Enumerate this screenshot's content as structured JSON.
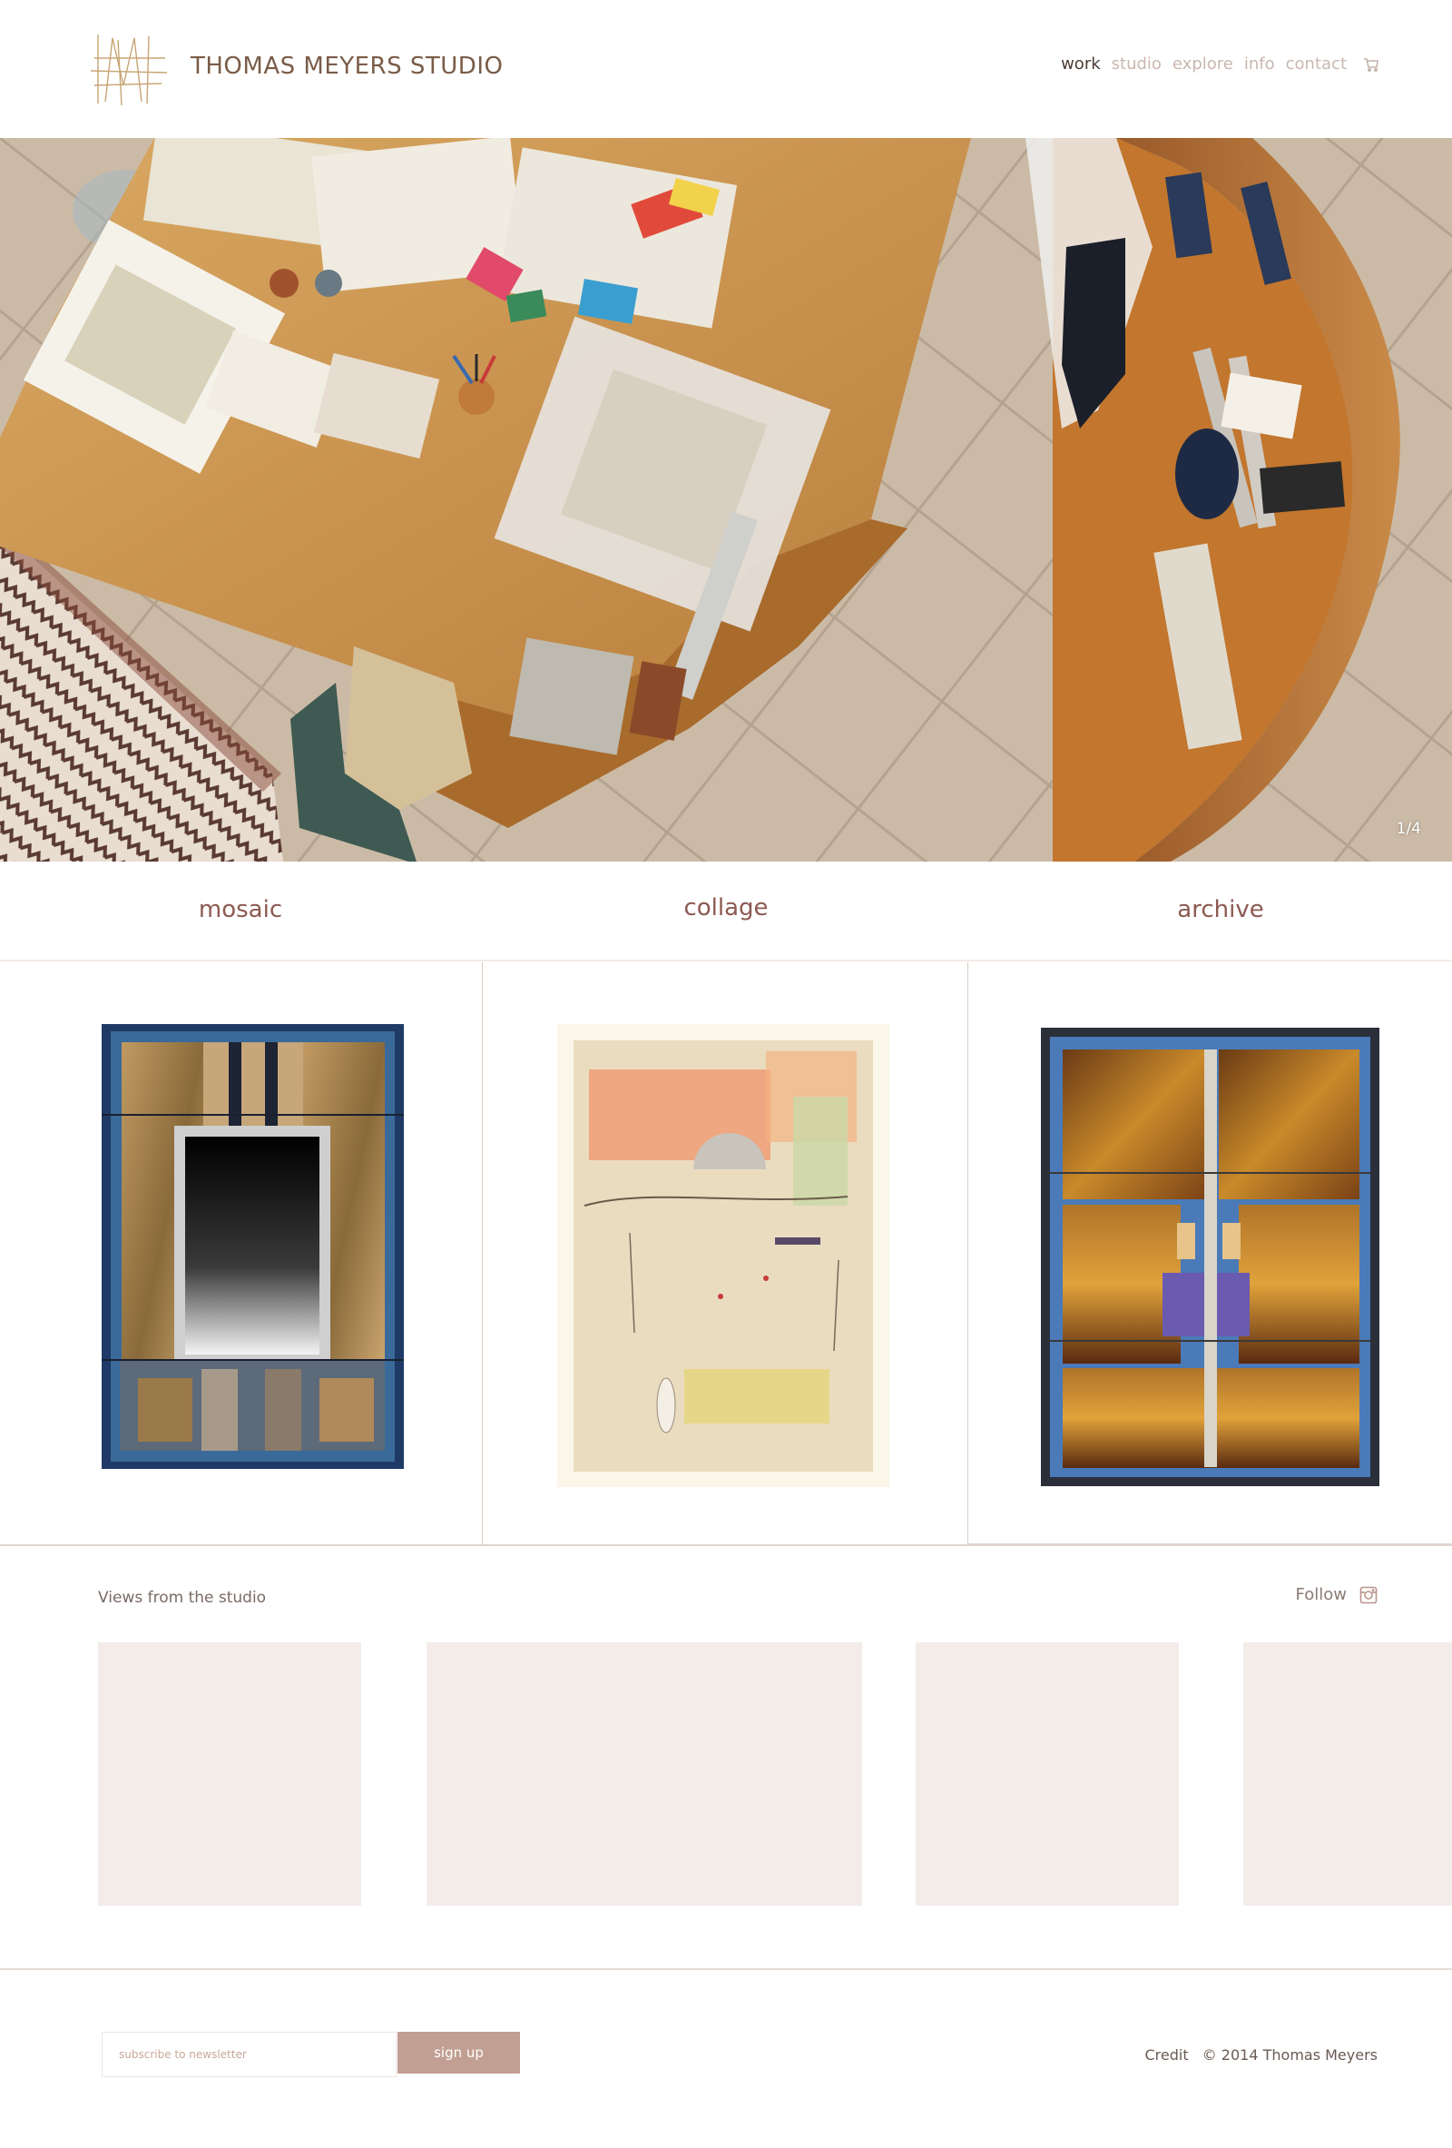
{
  "header": {
    "brand": "THOMAS MEYERS STUDIO",
    "nav": [
      {
        "label": "work",
        "active": true
      },
      {
        "label": "studio",
        "active": false
      },
      {
        "label": "explore",
        "active": false
      },
      {
        "label": "info",
        "active": false
      },
      {
        "label": "contact",
        "active": false
      }
    ],
    "cart_icon": "cart-icon"
  },
  "hero": {
    "counter": "1/4"
  },
  "categories": [
    "mosaic",
    "collage",
    "archive"
  ],
  "views": {
    "title": "Views from the studio",
    "follow_label": "Follow",
    "follow_icon": "instagram-icon"
  },
  "footer": {
    "newsletter_placeholder": "subscribe to newsletter",
    "signup_label": "sign up",
    "credit_label": "Credit",
    "copyright": "© 2014 Thomas Meyers"
  },
  "colors": {
    "accent": "#c19f93",
    "category_text": "#8c5a52",
    "placeholder_bg": "#f4ece8"
  }
}
